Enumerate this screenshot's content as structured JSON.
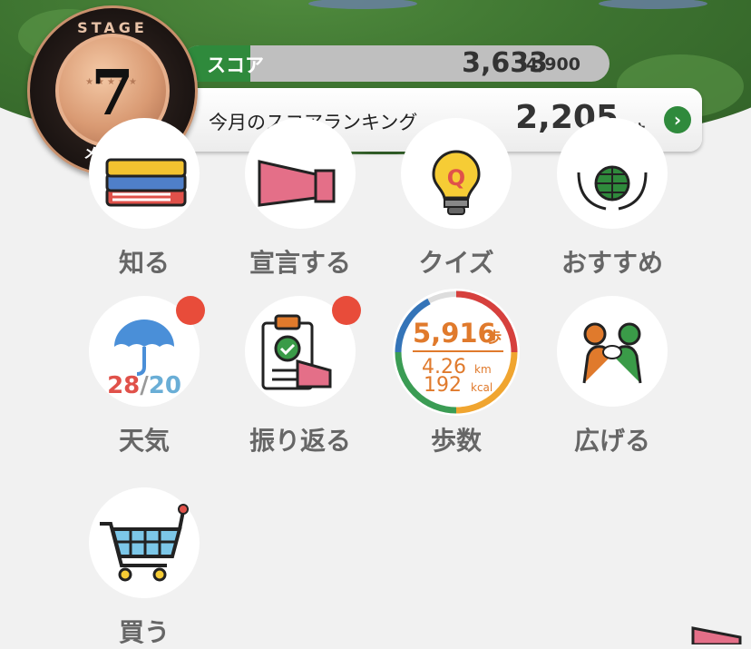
{
  "score": {
    "label": "スコア",
    "value": "3,633",
    "max": "/4,900"
  },
  "ranking": {
    "label": "今月のスコアランキング",
    "value": "2,205",
    "unit": "位"
  },
  "badge": {
    "stage_text": "STAGE",
    "level": "7",
    "rank_name": "メンバー"
  },
  "menu": [
    {
      "label": "知る",
      "icon": "books-icon"
    },
    {
      "label": "宣言する",
      "icon": "megaphone-icon"
    },
    {
      "label": "クイズ",
      "icon": "lightbulb-quiz-icon"
    },
    {
      "label": "おすすめ",
      "icon": "globe-hands-icon"
    },
    {
      "label": "天気",
      "icon": "umbrella-icon",
      "high": "28",
      "sep": "/",
      "low": "20",
      "has_notification": true
    },
    {
      "label": "振り返る",
      "icon": "clipboard-check-icon",
      "has_notification": true
    },
    {
      "label": "歩数",
      "icon": "steps-ring-icon",
      "steps": "5,916",
      "steps_unit": "歩",
      "distance": "4.26",
      "distance_unit": "km",
      "calories": "192",
      "calories_unit": "kcal"
    },
    {
      "label": "広げる",
      "icon": "people-pushing-icon"
    },
    {
      "label": "買う",
      "icon": "shopping-cart-icon"
    }
  ],
  "colors": {
    "accent_green": "#2f8a3c",
    "notification": "#e84c3a",
    "steps_orange": "#e07a2c"
  }
}
